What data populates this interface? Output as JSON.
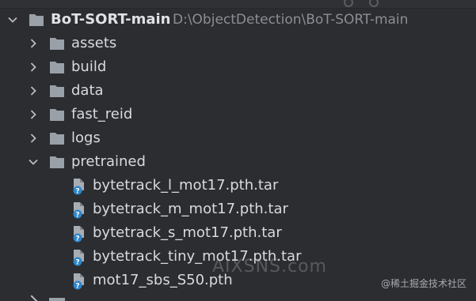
{
  "project": {
    "name": "BoT-SORT-main",
    "path": "D:\\ObjectDetection\\BoT-SORT-main"
  },
  "folders": [
    {
      "name": "assets",
      "expanded": false
    },
    {
      "name": "build",
      "expanded": false
    },
    {
      "name": "data",
      "expanded": false
    },
    {
      "name": "fast_reid",
      "expanded": false
    },
    {
      "name": "logs",
      "expanded": false
    },
    {
      "name": "pretrained",
      "expanded": true
    }
  ],
  "pretrained_files": [
    {
      "name": "bytetrack_l_mot17.pth.tar",
      "icon": "unknown-file-icon"
    },
    {
      "name": "bytetrack_m_mot17.pth.tar",
      "icon": "unknown-file-icon"
    },
    {
      "name": "bytetrack_s_mot17.pth.tar",
      "icon": "unknown-file-icon"
    },
    {
      "name": "bytetrack_tiny_mot17.pth.tar",
      "icon": "unknown-file-icon"
    },
    {
      "name": "mot17_sbs_S50.pth",
      "icon": "unknown-file-icon"
    }
  ],
  "watermark": "AIXSNS.com",
  "badge": "@稀土掘金技术社区",
  "colors": {
    "background": "#2b2d30",
    "folder": "#9aa0a8",
    "file_badge": "#3d8fd1",
    "text": "#d7dae0",
    "path": "#8b8e94"
  }
}
